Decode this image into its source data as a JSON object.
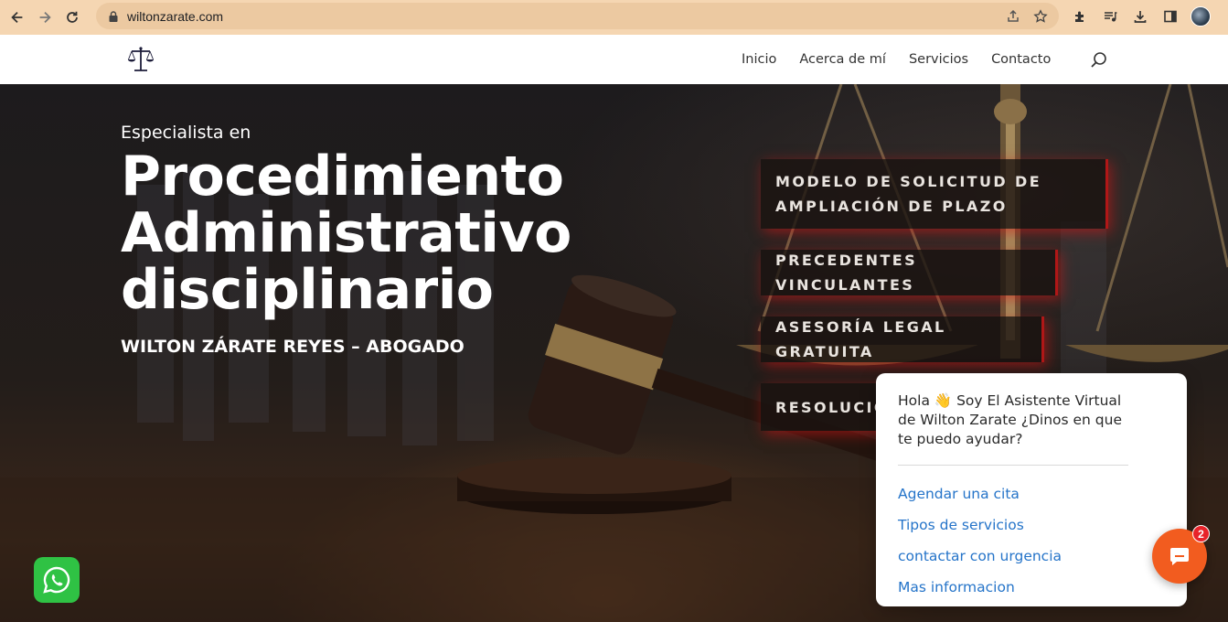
{
  "browser": {
    "url": "wiltonzarate.com",
    "icons": [
      "back-icon",
      "forward-icon",
      "reload-icon",
      "lock-icon",
      "share-icon",
      "star-icon",
      "extensions-icon",
      "media-icon",
      "download-icon",
      "sidebar-icon",
      "profile-avatar"
    ]
  },
  "site": {
    "nav": [
      "Inicio",
      "Acerca de mí",
      "Servicios",
      "Contacto"
    ]
  },
  "hero": {
    "kicker": "Especialista en",
    "headline": "Procedimiento Administrativo disciplinario",
    "subline": "WILTON ZÁRATE REYES – ABOGADO",
    "ctas": [
      "MODELO DE SOLICITUD DE AMPLIACIÓN DE PLAZO",
      "PRECEDENTES VINCULANTES",
      "ASESORÍA LEGAL GRATUITA",
      "RESOLUCIO"
    ]
  },
  "chat": {
    "greeting": "Hola 👋 Soy El Asistente Virtual de Wilton Zarate ¿Dinos en que te puedo ayudar?",
    "options": [
      "Agendar una cita",
      "Tipos de servicios",
      "contactar con urgencia",
      "Mas informacion"
    ],
    "badge": "2"
  },
  "colors": {
    "chrome": "#f5d6b2",
    "cta_glow": "#b01717",
    "chat_accent": "#f25c1f",
    "link": "#2574c9",
    "whatsapp": "#2fc244"
  }
}
